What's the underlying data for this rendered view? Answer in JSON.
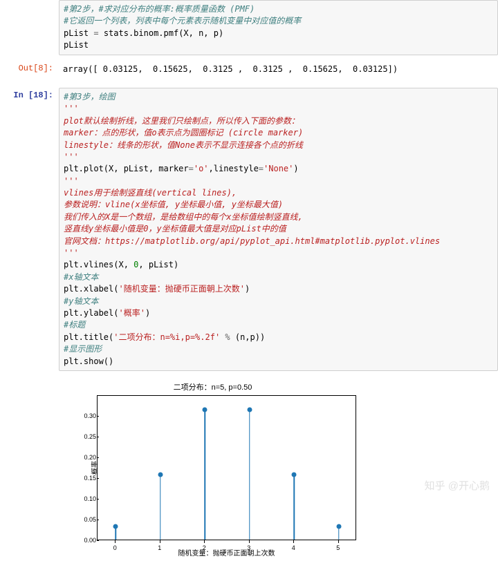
{
  "cell1": {
    "comment1": "#第2步，#求对应分布的概率:概率质量函数 (PMF)",
    "comment2": "#它返回一个列表，列表中每个元素表示随机变量中对应值的概率",
    "line1_a": "pList ",
    "line1_b": "=",
    "line1_c": " stats.binom.pmf(X, n, p)",
    "line2": "pList"
  },
  "out8": {
    "prompt": "Out[8]:",
    "text": "array([ 0.03125,  0.15625,  0.3125 ,  0.3125 ,  0.15625,  0.03125])"
  },
  "in18": {
    "prompt": "In [18]:",
    "comment1": "#第3步，绘图",
    "doc1a": "'''",
    "doc1b": "plot默认绘制折线，这里我们只绘制点，所以传入下面的参数：",
    "doc1c": "marker：点的形状，值o表示点为圆圈标记 (circle marker)",
    "doc1d": "linestyle：线条的形状，值None表示不显示连接各个点的折线",
    "doc1e": "'''",
    "plot_a": "plt.plot(X, pList, marker",
    "plot_eq": "=",
    "plot_s1": "'o'",
    "plot_comma": ",linestyle",
    "plot_eq2": "=",
    "plot_s2": "'None'",
    "plot_close": ")",
    "doc2a": "'''",
    "doc2b": "vlines用于绘制竖直线(vertical lines),",
    "doc2c": "参数说明：vline(x坐标值, y坐标最小值, y坐标最大值)",
    "doc2d": "我们传入的X是一个数组，是给数组中的每个x坐标值绘制竖直线,",
    "doc2e": "竖直线y坐标最小值是0，y坐标值最大值是对应pList中的值",
    "doc2f": "官网文档：https://matplotlib.org/api/pyplot_api.html#matplotlib.pyplot.vlines",
    "doc2g": "'''",
    "vlines_a": "plt.vlines(X, ",
    "vlines_zero": "0",
    "vlines_b": ", pList)",
    "cx": "#x轴文本",
    "xlabel_a": "plt.xlabel(",
    "xlabel_s": "'随机变量：抛硬币正面朝上次数'",
    "xlabel_b": ")",
    "cy": "#y轴文本",
    "ylabel_a": "plt.ylabel(",
    "ylabel_s": "'概率'",
    "ylabel_b": ")",
    "ct": "#标题",
    "title_a": "plt.title(",
    "title_s": "'二项分布：n=%i,p=%.2f'",
    "title_pct": " % ",
    "title_b": "(n,p))",
    "cs": "#显示图形",
    "show": "plt.show()"
  },
  "chart_data": {
    "type": "bar",
    "title": "二项分布：n=5, p=0.50",
    "xlabel": "随机变量：抛硬币正面朝上次数",
    "ylabel": "概率",
    "categories": [
      0,
      1,
      2,
      3,
      4,
      5
    ],
    "values": [
      0.03125,
      0.15625,
      0.3125,
      0.3125,
      0.15625,
      0.03125
    ],
    "ylim": [
      0,
      0.35
    ],
    "yticks": [
      0.0,
      0.05,
      0.1,
      0.15,
      0.2,
      0.25,
      0.3
    ]
  },
  "watermark": "知乎 @开心鹅"
}
